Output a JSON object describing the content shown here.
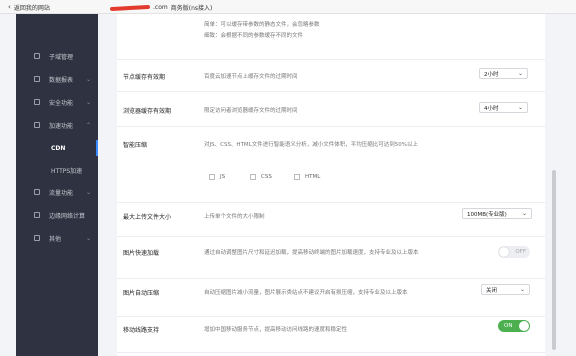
{
  "topbar": {
    "back_label": "返回我的网站",
    "domain_suffix": ".com",
    "plan": "商务版(ns接入)"
  },
  "sidebar": {
    "items": [
      {
        "label": "子域管理"
      },
      {
        "label": "数据报表"
      },
      {
        "label": "安全功能"
      },
      {
        "label": "加速功能"
      },
      {
        "label": "CDN"
      },
      {
        "label": "HTTPS加速"
      },
      {
        "label": "流量功能"
      },
      {
        "label": "边缘网络计算"
      },
      {
        "label": "其他"
      }
    ]
  },
  "main": {
    "top_text": {
      "line1": "简单：可以缓存带参数的静态文件，会忽略参数",
      "line2": "细致：会根据不同的参数缓存不同的文件"
    },
    "rows": {
      "node_cache": {
        "label": "节点缓存有效期",
        "desc": "百度云加速节点上缓存文件的过期时间",
        "value": "2小时"
      },
      "browser_cache": {
        "label": "浏览器缓存有效期",
        "desc": "限定访问者浏览器缓存文件的过期时间",
        "value": "4小时"
      },
      "smart_compress": {
        "label": "智能压缩",
        "desc": "对JS、CSS、HTML文件进行智能语义分析，减小文件体积，平均压缩比可达到50%以上",
        "opt_js": "JS",
        "opt_css": "CSS",
        "opt_html": "HTML"
      },
      "max_upload": {
        "label": "最大上传文件大小",
        "desc": "上传单个文件的大小限制",
        "value": "100MB(专业版)"
      },
      "image_fast": {
        "label": "图片快速加载",
        "desc": "通过自动调整图片尺寸和延迟加载，提高移动终端的图片加载速度，支持专业及以上版本",
        "state": "OFF"
      },
      "image_auto": {
        "label": "图片自动压缩",
        "desc": "自动压缩图片减小流量，图片展示类站点不建议开启有损压缩，支持专业及以上版本",
        "value": "关闭"
      },
      "mobile_line": {
        "label": "移动线路支持",
        "desc": "增加中国移动服务节点，提高移动访问线路的速度和稳定性",
        "state": "ON"
      }
    }
  }
}
